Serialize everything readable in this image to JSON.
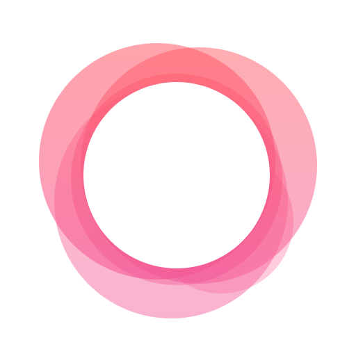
{
  "logo": {
    "icon": "overlapping-rings-logo-icon",
    "colors": {
      "background": "#ffffff",
      "ring_top": "#ff5a66",
      "ring_bottom": "#f25599",
      "ring_light": "#ffb3cf"
    }
  }
}
